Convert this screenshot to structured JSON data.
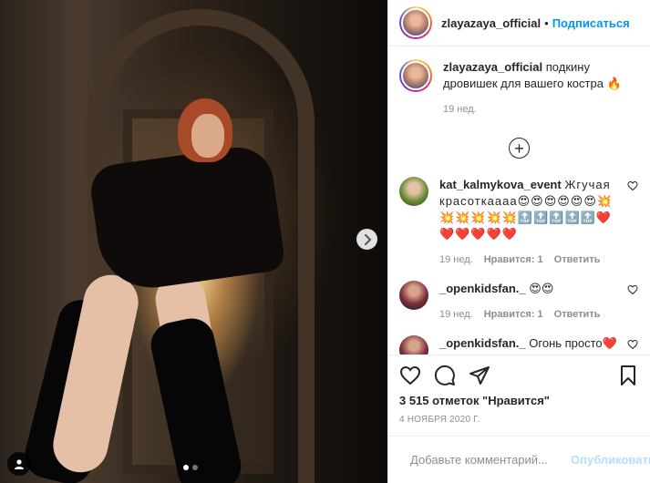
{
  "post": {
    "author": "zlayazaya_official",
    "follow_label": "Подписаться",
    "separator": "•",
    "caption_text": "подкину дровишек для вашего костра 🔥",
    "caption_age": "19 нед.",
    "likes_text": "3 515 отметок \"Нравится\"",
    "date_text": "4 ноября 2020 г.",
    "add_comment_placeholder": "Добавьте комментарий...",
    "publish_label": "Опубликовать",
    "load_more_symbol": "+"
  },
  "comments": [
    {
      "user": "kat_kalmykova_event",
      "text": "Жгучая красоткаааа😍😍😍😍😍😍💥💥💥💥💥💥🔝🔝🔝🔝🔝❤️❤️❤️❤️❤️❤️",
      "age": "19 нед.",
      "likes": "Нравится: 1",
      "reply": "Ответить"
    },
    {
      "user": "_openkidsfan._",
      "text": "😍😍",
      "age": "19 нед.",
      "likes": "Нравится: 1",
      "reply": "Ответить"
    },
    {
      "user": "_openkidsfan._",
      "text": "Огонь просто❤️"
    }
  ],
  "icons": {
    "like": "heart-icon",
    "comment": "comment-icon",
    "share": "paper-plane-icon",
    "save": "bookmark-icon",
    "emoji": "smiley-icon",
    "next": "chevron-right-icon",
    "tag": "person-icon"
  },
  "colors": {
    "accent": "#0095f6",
    "publish_disabled": "#b2dffc",
    "secondary_text": "#8e8e8e",
    "text": "#262626"
  },
  "carousel": {
    "total": 2,
    "current": 1
  }
}
